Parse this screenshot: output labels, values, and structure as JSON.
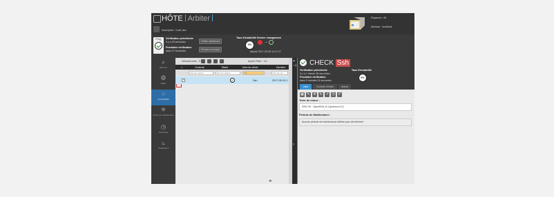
{
  "header": {
    "title": "HÔTE",
    "host_name": "Arbiter",
    "description": "Description : host1 des",
    "realm_label": "Royaume : All",
    "address_label": "Adresse : localhost"
  },
  "summary": {
    "prog_label": "Prog.",
    "prev_check_label": "Vérification précédente",
    "prev_check_value": "Il y a 33 secondes",
    "next_check_label": "Prochaine vérification",
    "next_check_value": "dans 27 secondes",
    "verify_button": "Vérifier maintenant",
    "account_button": "Prendre en compte",
    "instability_label": "Taux d'instabilité",
    "instability_value": "0%",
    "last_change_label": "Dernier changement",
    "last_change_date": "depuis 2017-03-06 14:17:17"
  },
  "sidebar": [
    {
      "label": "Résumé",
      "icon": "search-icon"
    },
    {
      "label": "Hôtes",
      "icon": "hosts-icon"
    },
    {
      "label": "Les Checks",
      "icon": "checks-icon"
    },
    {
      "label": "Arrêts de maintenance",
      "icon": "maintenance-icon"
    },
    {
      "label": "Historique",
      "icon": "history-icon"
    },
    {
      "label": "Graphiques",
      "icon": "graph-icon"
    }
  ],
  "table": {
    "selected_label": "Sélectionnés : 0",
    "filter_label": "Après Filtre : 1/1",
    "columns": [
      "Contexte",
      "Statut",
      "Nom du check",
      "Dernière"
    ],
    "filters": [
      "Pas de sélecti",
      "Pas de sélecti",
      "ssh",
      "Pas de sél"
    ],
    "rows": [
      {
        "name": "Ssh",
        "last": "2017-05-24 1"
      }
    ]
  },
  "detail": {
    "title": "CHECK",
    "service": "Ssh",
    "prev_check_label": "Vérification précédente",
    "prev_check_value": "Il y a 1 minute 36 secondes",
    "next_check_label": "Prochaine vérification",
    "next_check_value": "dans 3 minutes 24 secondes",
    "instability_label": "Taux d'instabilité",
    "instability_value": "0%",
    "tabs": [
      "Infos",
      "Contexte et histoi",
      "Avancé"
    ],
    "return_label": "Texte de retour :",
    "return_value": "SSH OK - OpenSSH_5.3 (protocol 2.0)",
    "maintenance_label": "Période de Maintenance :",
    "maintenance_value": "Aucune période de maintenance définie pour cet élément"
  },
  "colors": {
    "accent": "#2d6ea8",
    "header_bg": "#333333",
    "selected_row": "#c5e3f4",
    "filter_highlight": "#f5cc78",
    "status_red": "#d33333",
    "service_badge": "#c94a4a"
  }
}
